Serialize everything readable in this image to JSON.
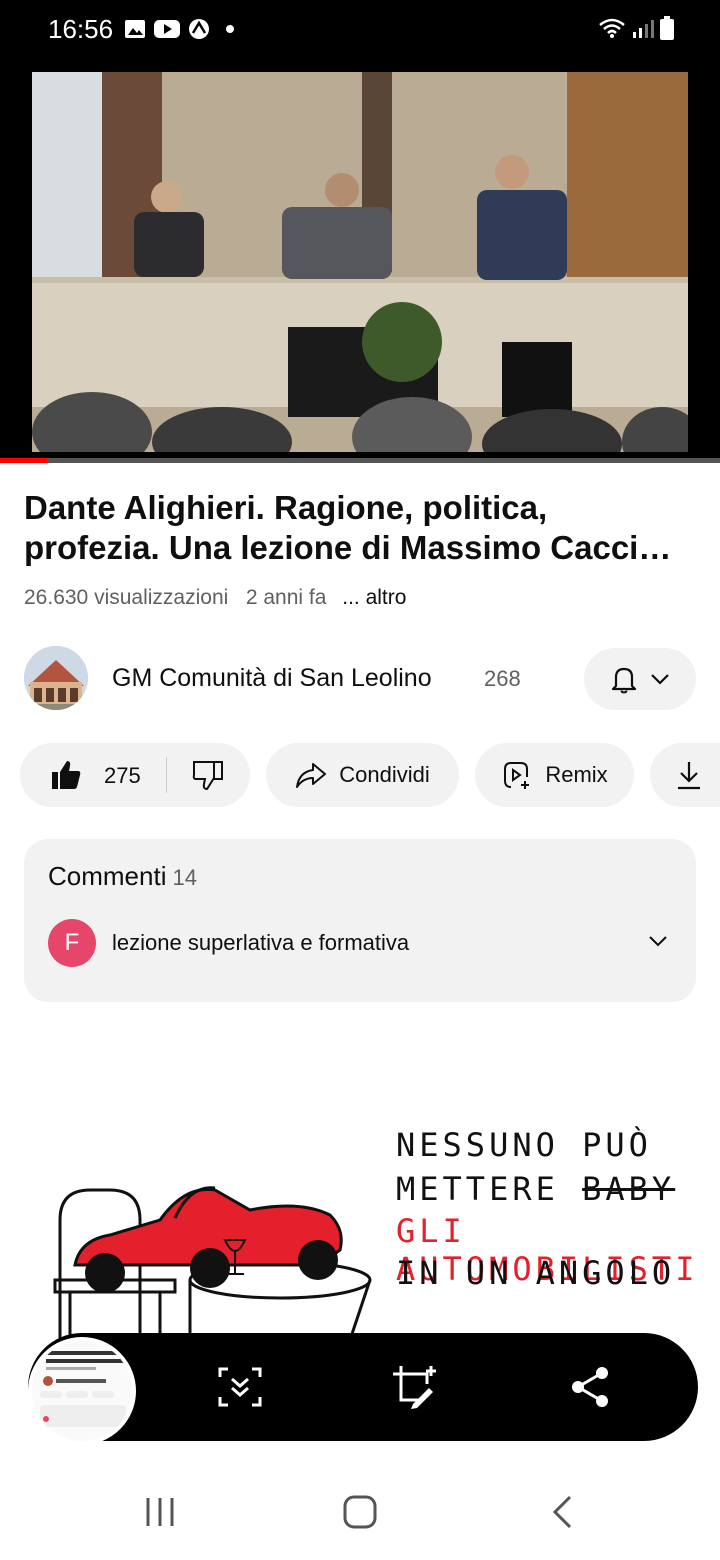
{
  "status_bar": {
    "time": "16:56"
  },
  "video": {
    "progress_fraction": 0.065
  },
  "title": {
    "line1": "Dante Alighieri. Ragione, politica,",
    "line2": "profezia. Una lezione di Massimo Cacci…"
  },
  "meta": {
    "views": "26.630 visualizzazioni",
    "age": "2 anni fa",
    "more": "... altro"
  },
  "channel": {
    "name": "GM Comunità di San Leolino",
    "subscribers": "268"
  },
  "actions": {
    "likes": "275",
    "share": "Condividi",
    "remix": "Remix"
  },
  "comments": {
    "label": "Commenti",
    "count": "14",
    "first_author_initial": "F",
    "first_text": "lezione superlativa e formativa"
  },
  "ad": {
    "line1": "NESSUNO PUÒ",
    "line2_a": "METTERE",
    "line2_b": "BABY",
    "line3": "GLI AUTOMOBILISTI",
    "line4": "IN UN ANGOLO"
  },
  "colors": {
    "accent": "#ff0000",
    "comment_avatar": "#e7466b",
    "ad_red": "#e3202b"
  }
}
